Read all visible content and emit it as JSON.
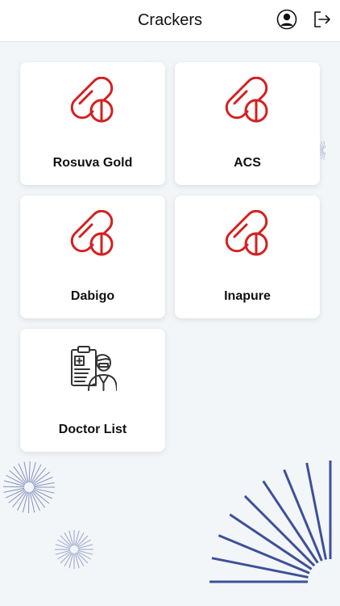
{
  "header": {
    "title": "Crackers",
    "profile_icon": "user-circle-icon",
    "logout_icon": "logout-icon"
  },
  "colors": {
    "pill_red": "#d42020",
    "decor_blue": "#2b3f8f",
    "background": "#f3f6f9"
  },
  "cards": [
    {
      "label": "Rosuva Gold",
      "icon": "pill-capsule-icon"
    },
    {
      "label": "ACS",
      "icon": "pill-capsule-icon"
    },
    {
      "label": "Dabigo",
      "icon": "pill-capsule-icon"
    },
    {
      "label": "Inapure",
      "icon": "pill-capsule-icon"
    },
    {
      "label": "Doctor List",
      "icon": "doctor-clipboard-icon"
    }
  ]
}
